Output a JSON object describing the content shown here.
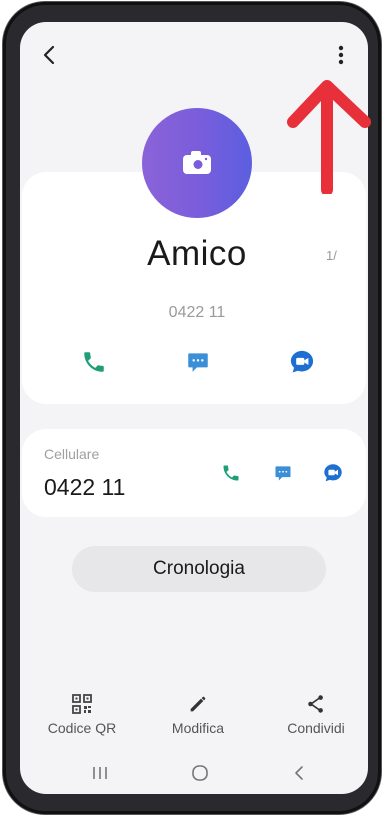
{
  "contact": {
    "name": "Amico",
    "number": "0422 11",
    "favorite_mark": "1/"
  },
  "phone_row": {
    "label": "Cellulare",
    "number": "0422 11"
  },
  "history": {
    "label": "Cronologia"
  },
  "bottom_bar": {
    "qr_label": "Codice QR",
    "edit_label": "Modifica",
    "share_label": "Condividi"
  },
  "icons": {
    "back": "back-arrow-icon",
    "more": "more-vertical-icon",
    "avatar": "camera-icon",
    "call": "phone-icon",
    "message": "message-icon",
    "video": "video-call-icon",
    "qr": "qr-code-icon",
    "edit": "pencil-icon",
    "share": "share-icon"
  },
  "colors": {
    "call_green": "#1f9e78",
    "message_blue": "#3a8fd6",
    "video_blue": "#1d6fd1",
    "avatar_gradient_start": "#8a63d8",
    "avatar_gradient_end": "#5b5fe0",
    "annotation_red": "#e8303a"
  }
}
